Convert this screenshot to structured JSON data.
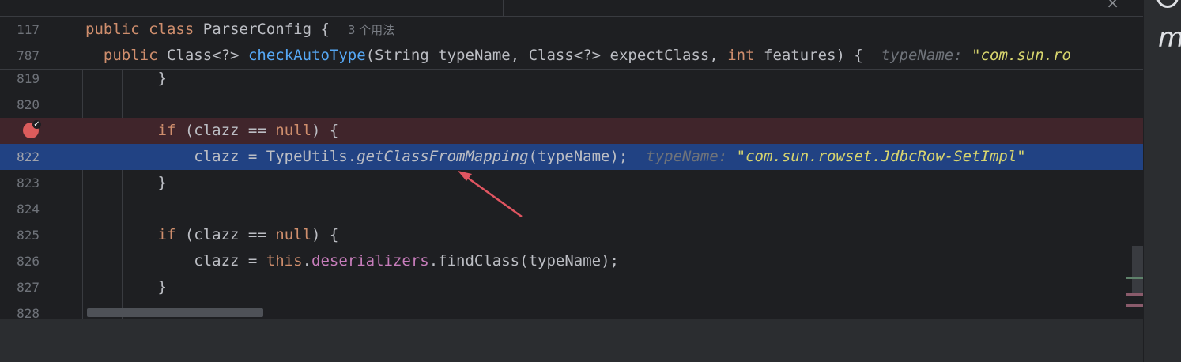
{
  "tab_strip": {
    "close_glyph": "×"
  },
  "sticky": {
    "line1": {
      "num": "117",
      "kw_public": "public",
      "kw_class": "class",
      "class_name": "ParserConfig",
      "brace": "{",
      "usages": "3 个用法"
    },
    "line2": {
      "num": "787",
      "kw_public": "public",
      "type": "Class<?>",
      "method": "checkAutoType",
      "params_a": "(String typeName, Class<?> expectClass, ",
      "kw_int": "int",
      "params_b": " features) {",
      "hint_label": "typeName:",
      "hint_value": "\"com.sun.ro"
    }
  },
  "lines": [
    {
      "num": "819",
      "text": "}"
    },
    {
      "num": "820"
    },
    {
      "num": "",
      "kw_if": "if",
      "cond_a": " (clazz == ",
      "kw_null": "null",
      "cond_b": ") {",
      "breakpoint_icon": "breakpoint-check-icon"
    },
    {
      "num": "822",
      "pre": "clazz = TypeUtils.",
      "method": "getClassFromMapping",
      "post": "(typeName);",
      "hint_label": "typeName:",
      "hint_value": "\"com.sun.rowset.JdbcRow-SetImpl\""
    },
    {
      "num": "823",
      "text": "}"
    },
    {
      "num": "824"
    },
    {
      "num": "825",
      "kw_if": "if",
      "cond_a": " (clazz == ",
      "kw_null": "null",
      "cond_b": ") {"
    },
    {
      "num": "826",
      "pre": "clazz = ",
      "kw_this": "this",
      "dot": ".",
      "field": "deserializers",
      "post": ".findClass(typeName);"
    },
    {
      "num": "827",
      "text": "}"
    },
    {
      "num": "828"
    }
  ],
  "right_panel": {
    "letter": "m"
  },
  "colors": {
    "editor_bg": "#1e1f22",
    "current_line": "#214283",
    "breakpoint_line": "#40252b",
    "keyword": "#cf8e6d",
    "method": "#56a8f5",
    "field": "#c77dbb",
    "string": "#d8d56e",
    "arrow": "#e05561"
  }
}
